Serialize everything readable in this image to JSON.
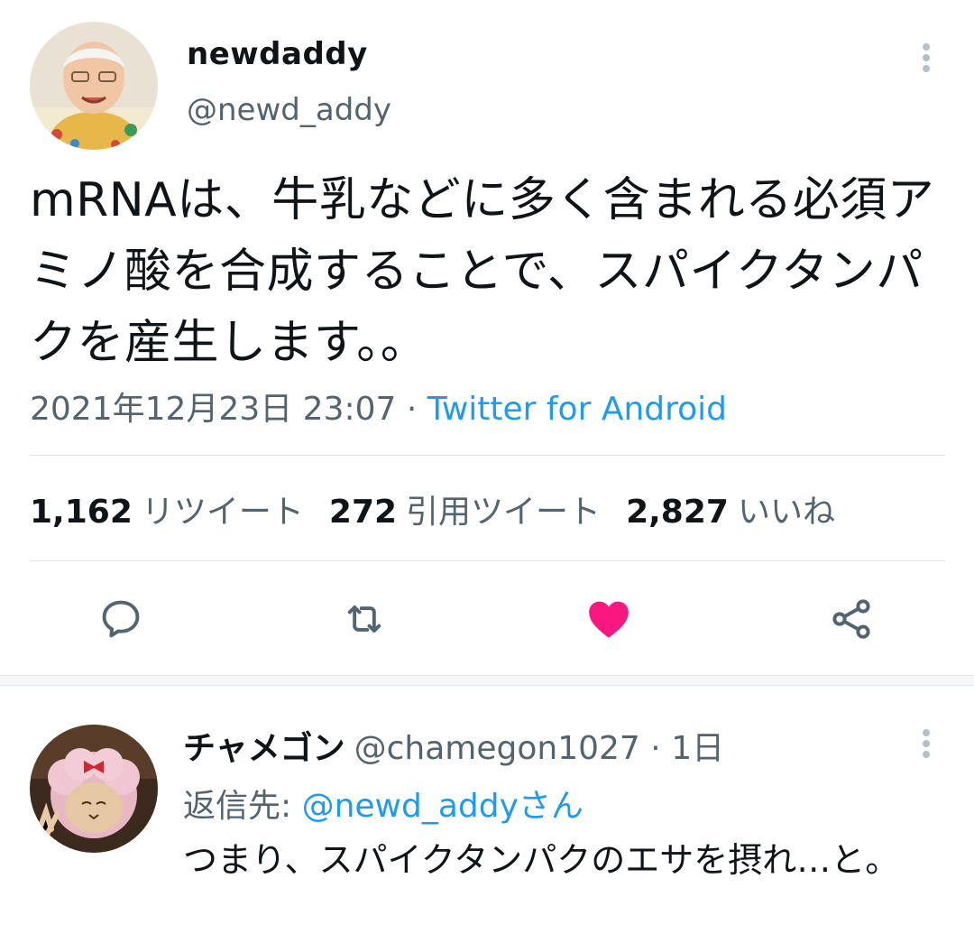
{
  "tweet": {
    "display_name": "newdaddy",
    "handle": "@newd_addy",
    "text": "mRNAは、牛乳などに多く含まれる必須アミノ酸を合成することで、スパイクタンパクを産生します。。",
    "timestamp": "2021年12月23日 23:07",
    "separator": " · ",
    "source": "Twitter for Android",
    "stats": {
      "retweets_count": "1,162",
      "retweets_label": "リツイート",
      "quotes_count": "272",
      "quotes_label": "引用ツイート",
      "likes_count": "2,827",
      "likes_label": "いいね"
    },
    "actions": {
      "reply_icon": "reply-icon",
      "retweet_icon": "retweet-icon",
      "like_icon": "heart-icon",
      "share_icon": "share-icon",
      "liked": true
    }
  },
  "reply": {
    "display_name": "チャメゴン",
    "handle": "@chamegon1027",
    "separator": " · ",
    "age": "1日",
    "reply_to_label": "返信先: ",
    "reply_to_handle": "@newd_addyさん",
    "text": "つまり、スパイクタンパクのエサを摂れ…と。"
  },
  "colors": {
    "accent": "#1d9bf0",
    "like": "#f91880",
    "secondary_text": "#536471",
    "primary_text": "#0f1419"
  }
}
